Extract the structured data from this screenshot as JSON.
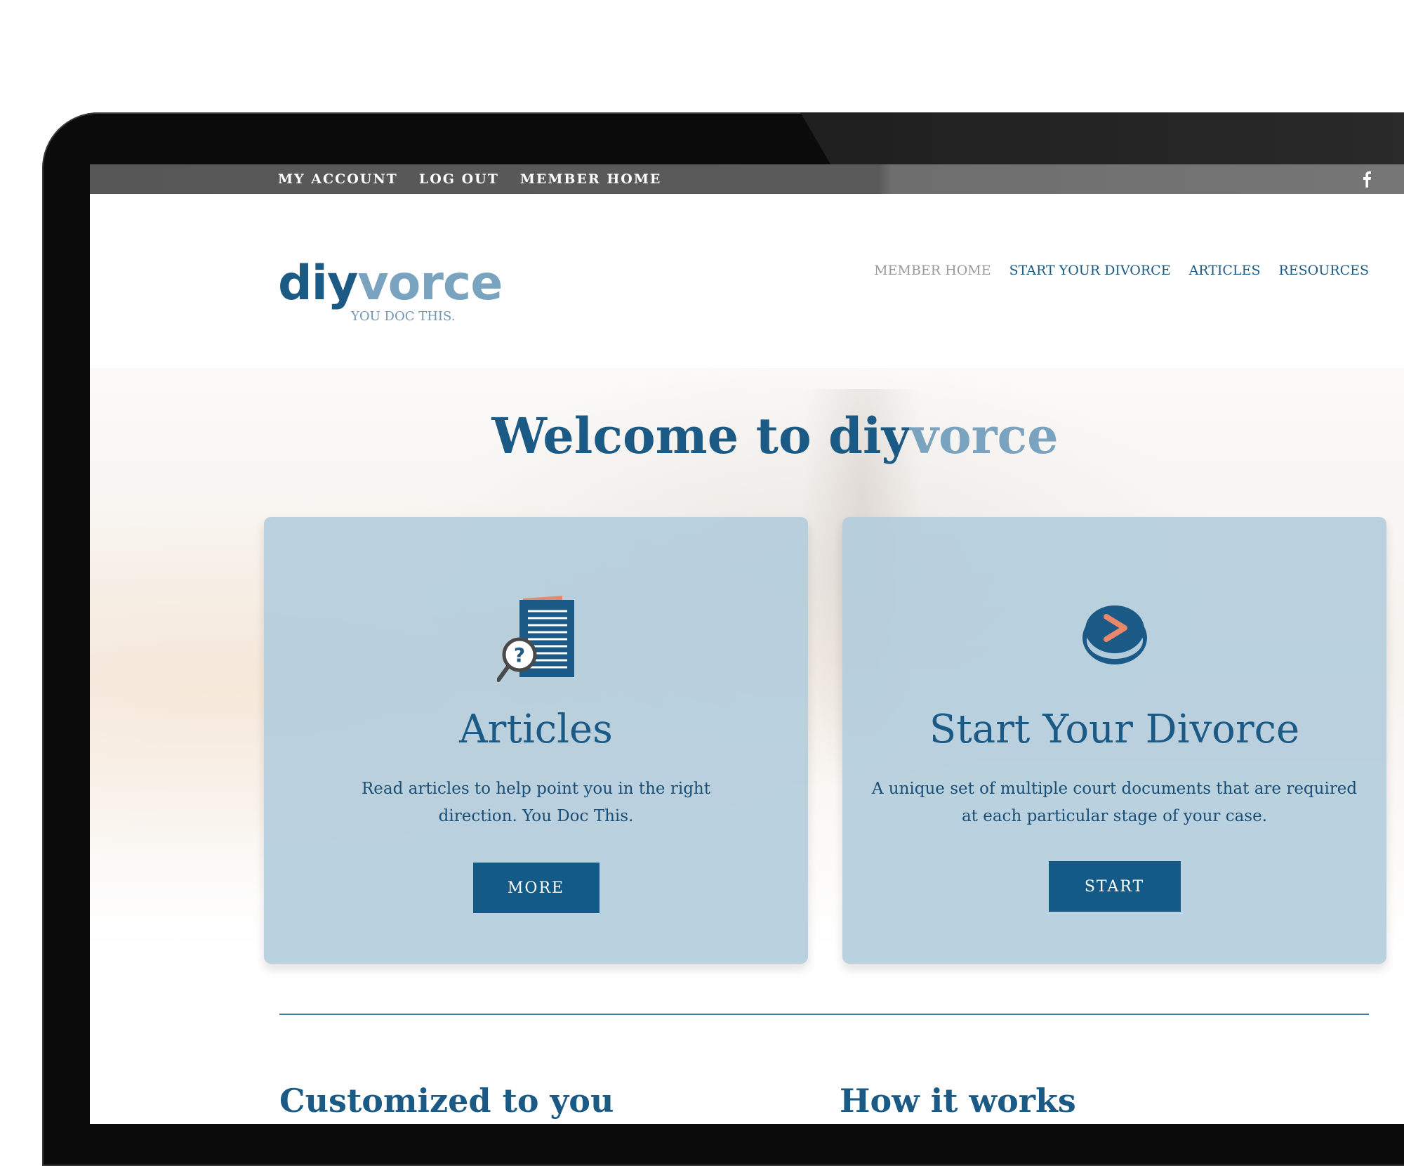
{
  "topbar": {
    "links": [
      "MY ACCOUNT",
      "LOG OUT",
      "MEMBER HOME"
    ],
    "social_icon": "facebook-icon"
  },
  "logo": {
    "di": "di",
    "y": "y",
    "rest": "vorce",
    "tagline": "YOU DOC THIS."
  },
  "nav": {
    "items": [
      "MEMBER HOME",
      "START YOUR DIVORCE",
      "ARTICLES",
      "RESOURCES"
    ]
  },
  "hero": {
    "welcome_prefix": "Welcome to diy",
    "welcome_highlight": "vorce"
  },
  "cards": [
    {
      "icon": "document-search-icon",
      "title": "Articles",
      "description": "Read articles to help point you in the right direction. You Doc This.",
      "button": "MORE"
    },
    {
      "icon": "start-button-icon",
      "title": "Start Your Divorce",
      "description": "A unique set of multiple court documents that are required at each particular stage of your case.",
      "button": "START"
    }
  ],
  "sections": {
    "left_heading": "Customized to you",
    "right_heading": "How it works"
  },
  "colors": {
    "brand_dark": "#1c5a86",
    "brand_light": "#7aa3bf",
    "card_bg": "#b2ccdb",
    "button_bg": "#145a86",
    "accent_orange": "#e8876a"
  }
}
